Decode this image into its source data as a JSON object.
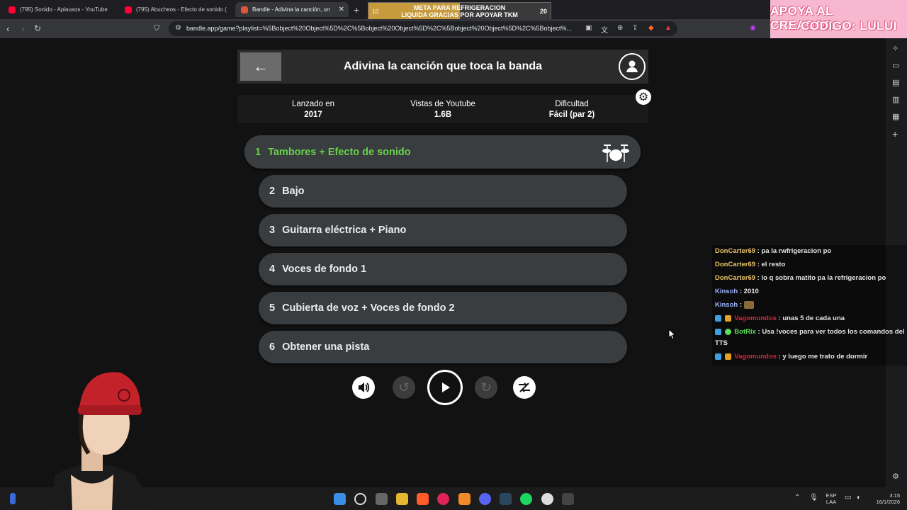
{
  "browser": {
    "tabs": [
      {
        "label": "(795) Sonido - Aplausos - YouTube",
        "favicon_color": "#ff0033"
      },
      {
        "label": "(795) Abucheos - Efecto de sonido (I",
        "favicon_color": "#ff0033"
      },
      {
        "label": "Bandle - Adivina la canción, un",
        "favicon_color": "#e0543a"
      }
    ],
    "url": "bandle.app/game?playlist=%5Bobject%20Object%5D%2C%5Bobject%20Object%5D%2C%5Bobject%20Object%5D%2C%5Bobject%..."
  },
  "overlay": {
    "goal_line1": "META PARA REFRIGERACION",
    "goal_line2": "LIQUIDA GRACIAS POR APOYAR TKM",
    "goal_start": "10",
    "goal_end": "20",
    "goal_progress": 0.5,
    "promo_line1": "APOYA AL CREADOR",
    "promo_line2": "CODIGO: LULUI"
  },
  "game": {
    "title": "Adivina la canción que toca la banda",
    "stats": [
      {
        "label": "Lanzado en",
        "value": "2017"
      },
      {
        "label": "Vistas de Youtube",
        "value": "1.6B"
      },
      {
        "label": "Dificultad",
        "value": "Fácil (par 2)"
      }
    ],
    "tracks": [
      {
        "num": "1",
        "label": "Tambores + Efecto de sonido"
      },
      {
        "num": "2",
        "label": "Bajo"
      },
      {
        "num": "3",
        "label": "Guitarra eléctrica + Piano"
      },
      {
        "num": "4",
        "label": "Voces de fondo 1"
      },
      {
        "num": "5",
        "label": "Cubierta de voz + Voces de fondo 2"
      },
      {
        "num": "6",
        "label": "Obtener una pista"
      }
    ],
    "active_color": "#66d14a"
  },
  "chat": {
    "messages": [
      {
        "user": "DonCarter69",
        "text": ": pa la rwfrigeracion po",
        "color": "#e8c56a"
      },
      {
        "user": "DonCarter69",
        "text": ": el resto",
        "color": "#e8c56a"
      },
      {
        "user": "DonCarter69",
        "text": ": lo q sobra matito pa la refrigeracion po",
        "color": "#e8c56a"
      },
      {
        "user": "Kinsoh",
        "text": ": 2010",
        "color": "#9fb6ff"
      },
      {
        "user": "Kinsoh",
        "text": ":",
        "color": "#9fb6ff"
      },
      {
        "user": "Vagomundos",
        "text": ": unas 5 de cada una",
        "color": "#d9263a"
      },
      {
        "user": "BotRix",
        "text": ": Usa !voces para ver todos los comandos del",
        "color": "#5be05b"
      },
      {
        "user": "",
        "text": "TTS",
        "color": "#e6e6e6"
      },
      {
        "user": "Vagomundos",
        "text": ": y luego me trato de dormir",
        "color": "#d9263a"
      }
    ]
  },
  "taskbar": {
    "lang1": "ESP",
    "lang2": "LAA",
    "time": "3:15",
    "date": "16/1/2026"
  }
}
